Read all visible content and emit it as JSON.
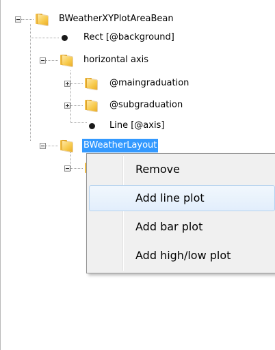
{
  "tree": {
    "root": {
      "label": "BWeatherXYPlotAreaBean"
    },
    "rect_background": {
      "label": "Rect [@background]"
    },
    "horizontal_axis": {
      "label": "horizontal axis"
    },
    "maingraduation": {
      "label": "@maingraduation"
    },
    "subgraduation": {
      "label": "@subgraduation"
    },
    "line_axis": {
      "label": "Line [@axis]"
    },
    "selected_node": {
      "label": "BWeatherLayout"
    }
  },
  "context_menu": {
    "items": [
      {
        "label": "Remove"
      },
      {
        "label": "Add line plot"
      },
      {
        "label": "Add bar plot"
      },
      {
        "label": "Add high/low plot"
      }
    ],
    "hovered_item": "Add line plot"
  },
  "colors": {
    "selection": "#3399ff",
    "menu_background": "#f0f0f0",
    "menu_hover": "#e2eefc"
  }
}
